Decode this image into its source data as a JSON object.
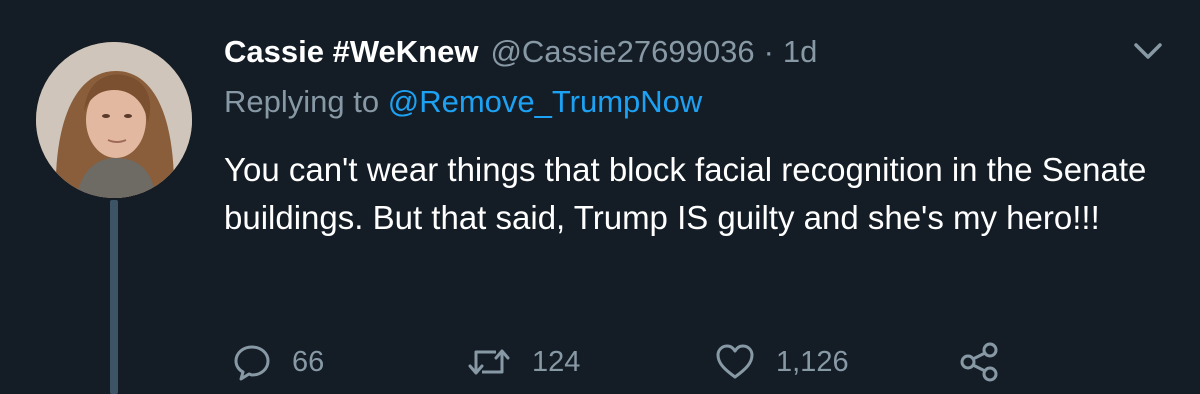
{
  "tweet": {
    "display_name": "Cassie #WeKnew",
    "handle": "@Cassie27699036",
    "separator": "·",
    "time": "1d",
    "reply_prefix": "Replying to",
    "reply_handle": "@Remove_TrumpNow",
    "text": "You can't wear things that block facial recognition in the Senate buildings. But that said, Trump IS guilty and she's my hero!!!",
    "avatar_icon": "profile-photo"
  },
  "actions": {
    "reply_count": "66",
    "retweet_count": "124",
    "like_count": "1,126",
    "reply_icon": "speech-bubble-icon",
    "retweet_icon": "retweet-arrows-icon",
    "like_icon": "heart-icon",
    "share_icon": "share-nodes-icon"
  },
  "colors": {
    "background": "#141d26",
    "secondary_text": "#8899a6",
    "link": "#1da1f2",
    "thread_line": "#3d5466"
  }
}
